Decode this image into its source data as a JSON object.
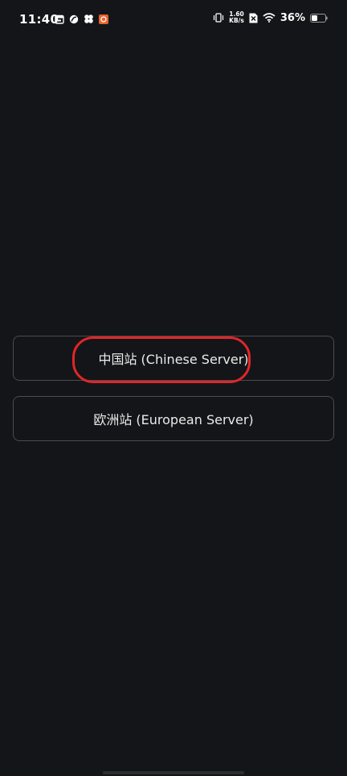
{
  "status_bar": {
    "time": "11:40",
    "net_speed_value": "1.60",
    "net_speed_unit": "KB/s",
    "battery_percent": "36%",
    "notification_icons": [
      "calendar-icon",
      "leaf-icon",
      "clover-icon",
      "orange-app-icon"
    ],
    "status_icons": [
      "vibrate-icon",
      "sim-off-icon",
      "wifi-icon",
      "battery-icon"
    ]
  },
  "servers": {
    "chinese_label": "中国站 (Chinese Server)",
    "european_label": "欧洲站 (European Server)"
  },
  "colors": {
    "background": "#141518",
    "button_border": "#4a4b50",
    "highlight": "#e0262a",
    "text": "#eaeaea"
  }
}
